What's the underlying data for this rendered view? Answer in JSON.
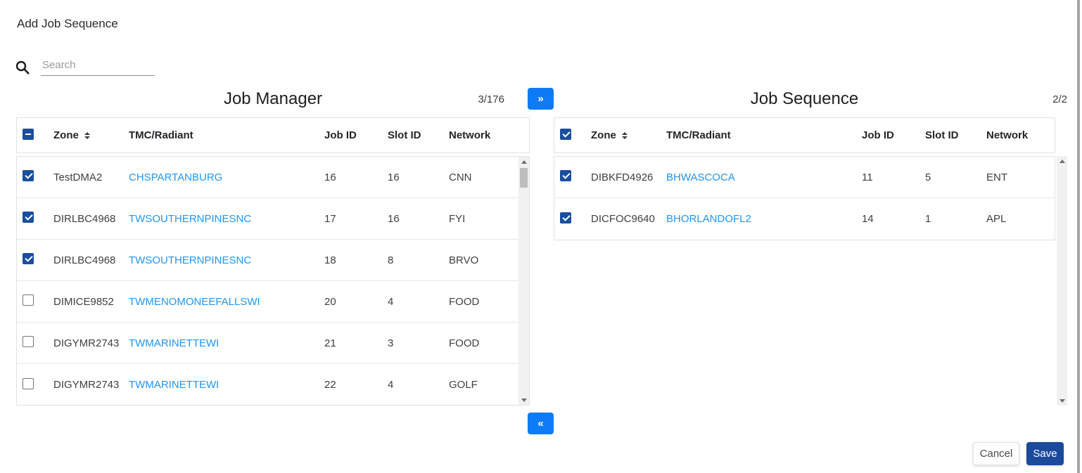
{
  "page": {
    "title": "Add Job Sequence"
  },
  "search": {
    "placeholder": "Search",
    "value": ""
  },
  "columns": {
    "zone": "Zone",
    "tmc": "TMC/Radiant",
    "job_id": "Job ID",
    "slot_id": "Slot ID",
    "network": "Network"
  },
  "job_manager": {
    "title": "Job Manager",
    "count": "3/176",
    "header_checkbox": "indeterminate",
    "rows": [
      {
        "checked": true,
        "zone": "TestDMA2",
        "tmc": "CHSPARTANBURG",
        "job_id": "16",
        "slot_id": "16",
        "network": "CNN"
      },
      {
        "checked": true,
        "zone": "DIRLBC4968",
        "tmc": "TWSOUTHERNPINESNC",
        "job_id": "17",
        "slot_id": "16",
        "network": "FYI"
      },
      {
        "checked": true,
        "zone": "DIRLBC4968",
        "tmc": "TWSOUTHERNPINESNC",
        "job_id": "18",
        "slot_id": "8",
        "network": "BRVO"
      },
      {
        "checked": false,
        "zone": "DIMICE9852",
        "tmc": "TWMENOMONEEFALLSWI",
        "job_id": "20",
        "slot_id": "4",
        "network": "FOOD"
      },
      {
        "checked": false,
        "zone": "DIGYMR2743",
        "tmc": "TWMARINETTEWI",
        "job_id": "21",
        "slot_id": "3",
        "network": "FOOD"
      },
      {
        "checked": false,
        "zone": "DIGYMR2743",
        "tmc": "TWMARINETTEWI",
        "job_id": "22",
        "slot_id": "4",
        "network": "GOLF"
      }
    ]
  },
  "job_sequence": {
    "title": "Job Sequence",
    "count": "2/2",
    "header_checkbox": "checked",
    "rows": [
      {
        "checked": true,
        "zone": "DIBKFD4926",
        "tmc": "BHWASCOCA",
        "job_id": "11",
        "slot_id": "5",
        "network": "ENT"
      },
      {
        "checked": true,
        "zone": "DICFOC9640",
        "tmc": "BHORLANDOFL2",
        "job_id": "14",
        "slot_id": "1",
        "network": "APL"
      }
    ]
  },
  "transfer": {
    "to_sequence_label": "»",
    "to_manager_label": "«"
  },
  "footer": {
    "cancel_label": "Cancel",
    "save_label": "Save"
  },
  "colors": {
    "transfer_button": "#0d7bf5",
    "save_button": "#1b4a9d",
    "checkbox": "#1a4e9e",
    "link": "#2196f3",
    "border": "#dee2e6"
  }
}
